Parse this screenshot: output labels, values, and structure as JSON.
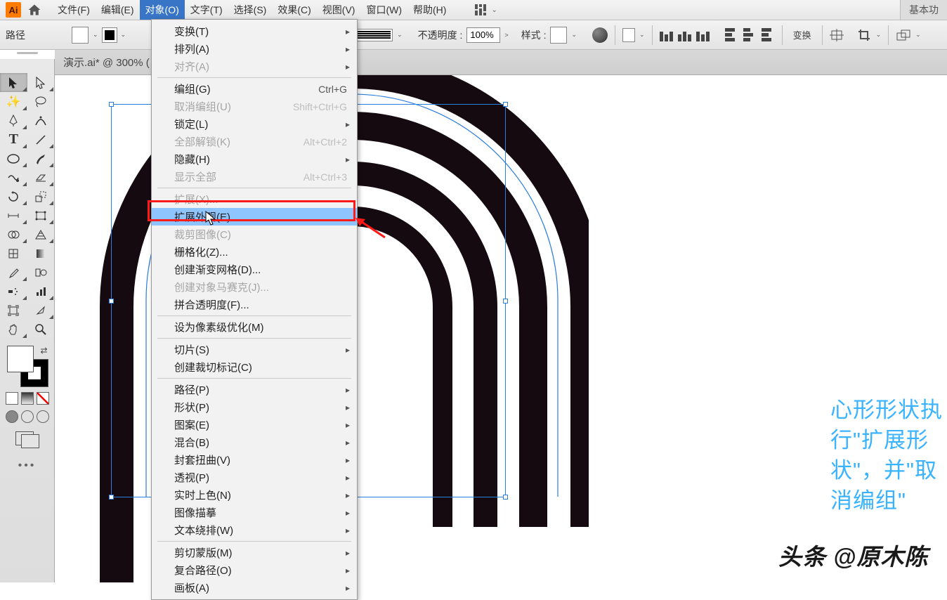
{
  "app": {
    "logo_text": "Ai"
  },
  "menu": {
    "file": "文件(F)",
    "edit": "编辑(E)",
    "object": "对象(O)",
    "type": "文字(T)",
    "select": "选择(S)",
    "effect": "效果(C)",
    "view": "视图(V)",
    "window": "窗口(W)",
    "help": "帮助(H)",
    "essentials": "基本功"
  },
  "ctrl": {
    "path_label": "路径",
    "opacity_label": "不透明度 :",
    "opacity_value": "100%",
    "style_label": "样式 :",
    "transform_btn": "变换"
  },
  "doc_tab": "演示.ai* @ 300% (",
  "dropdown": [
    {
      "label": "变换(T)",
      "sub": true
    },
    {
      "label": "排列(A)",
      "sub": true
    },
    {
      "label": "对齐(A)",
      "sub": true,
      "dis": true
    },
    "---",
    {
      "label": "编组(G)",
      "sc": "Ctrl+G"
    },
    {
      "label": "取消编组(U)",
      "sc": "Shift+Ctrl+G",
      "dis": true
    },
    {
      "label": "锁定(L)",
      "sub": true
    },
    {
      "label": "全部解锁(K)",
      "sc": "Alt+Ctrl+2",
      "dis": true
    },
    {
      "label": "隐藏(H)",
      "sub": true
    },
    {
      "label": "显示全部",
      "sc": "Alt+Ctrl+3",
      "dis": true
    },
    "---",
    {
      "label": "扩展(X)...",
      "dis": true
    },
    {
      "label": "扩展外观(E)",
      "hl": true
    },
    {
      "label": "裁剪图像(C)",
      "dis": true
    },
    {
      "label": "栅格化(Z)..."
    },
    {
      "label": "创建渐变网格(D)..."
    },
    {
      "label": "创建对象马赛克(J)...",
      "dis": true
    },
    {
      "label": "拼合透明度(F)..."
    },
    "---",
    {
      "label": "设为像素级优化(M)"
    },
    "---",
    {
      "label": "切片(S)",
      "sub": true
    },
    {
      "label": "创建裁切标记(C)"
    },
    "---",
    {
      "label": "路径(P)",
      "sub": true
    },
    {
      "label": "形状(P)",
      "sub": true
    },
    {
      "label": "图案(E)",
      "sub": true
    },
    {
      "label": "混合(B)",
      "sub": true
    },
    {
      "label": "封套扭曲(V)",
      "sub": true
    },
    {
      "label": "透视(P)",
      "sub": true
    },
    {
      "label": "实时上色(N)",
      "sub": true
    },
    {
      "label": "图像描摹",
      "sub": true
    },
    {
      "label": "文本绕排(W)",
      "sub": true
    },
    "---",
    {
      "label": "剪切蒙版(M)",
      "sub": true
    },
    {
      "label": "复合路径(O)",
      "sub": true
    },
    {
      "label": "画板(A)",
      "sub": true
    }
  ],
  "note_text": "心形形状执行\"扩展形状\"，并\"取消编组\"",
  "credit_text": "头条 @原木陈"
}
